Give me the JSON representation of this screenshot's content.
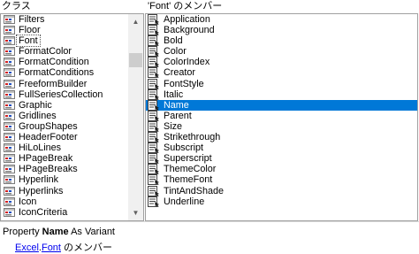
{
  "classes_pane": {
    "header": "クラス",
    "items": [
      {
        "label": "Filters"
      },
      {
        "label": "Floor"
      },
      {
        "label": "Font"
      },
      {
        "label": "FormatColor"
      },
      {
        "label": "FormatCondition"
      },
      {
        "label": "FormatConditions"
      },
      {
        "label": "FreeformBuilder"
      },
      {
        "label": "FullSeriesCollection"
      },
      {
        "label": "Graphic"
      },
      {
        "label": "Gridlines"
      },
      {
        "label": "GroupShapes"
      },
      {
        "label": "HeaderFooter"
      },
      {
        "label": "HiLoLines"
      },
      {
        "label": "HPageBreak"
      },
      {
        "label": "HPageBreaks"
      },
      {
        "label": "Hyperlink"
      },
      {
        "label": "Hyperlinks"
      },
      {
        "label": "Icon"
      },
      {
        "label": "IconCriteria"
      }
    ],
    "focused_item": "Font",
    "icon": "class-icon"
  },
  "members_pane": {
    "header": "'Font' のメンバー",
    "items": [
      {
        "label": "Application"
      },
      {
        "label": "Background"
      },
      {
        "label": "Bold"
      },
      {
        "label": "Color"
      },
      {
        "label": "ColorIndex"
      },
      {
        "label": "Creator"
      },
      {
        "label": "FontStyle"
      },
      {
        "label": "Italic"
      },
      {
        "label": "Name"
      },
      {
        "label": "Parent"
      },
      {
        "label": "Size"
      },
      {
        "label": "Strikethrough"
      },
      {
        "label": "Subscript"
      },
      {
        "label": "Superscript"
      },
      {
        "label": "ThemeColor"
      },
      {
        "label": "ThemeFont"
      },
      {
        "label": "TintAndShade"
      },
      {
        "label": "Underline"
      }
    ],
    "selected_item": "Name",
    "icon": "property-icon"
  },
  "details": {
    "prefix": "Property",
    "member_name": "Name",
    "type_text": "As Variant",
    "library_link": "Excel",
    "separator": ".",
    "class_link": "Font",
    "suffix": " のメンバー"
  },
  "colors": {
    "selection": "#0078d7",
    "link": "#0000ee"
  }
}
